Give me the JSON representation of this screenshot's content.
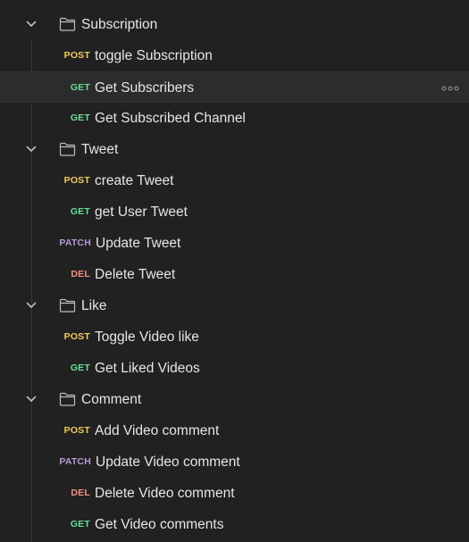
{
  "folders": [
    {
      "name": "Subscription",
      "icon": "folder-icon",
      "expanded": true,
      "requests": [
        {
          "method": "POST",
          "name": "toggle Subscription"
        },
        {
          "method": "GET",
          "name": "Get Subscribers",
          "active": true,
          "more_icon": "more-icon"
        },
        {
          "method": "GET",
          "name": "Get Subscribed Channel"
        }
      ]
    },
    {
      "name": "Tweet",
      "icon": "folder-icon",
      "expanded": true,
      "requests": [
        {
          "method": "POST",
          "name": "create Tweet"
        },
        {
          "method": "GET",
          "name": "get User Tweet"
        },
        {
          "method": "PATCH",
          "name": "Update Tweet"
        },
        {
          "method": "DEL",
          "name": "Delete Tweet"
        }
      ]
    },
    {
      "name": "Like",
      "icon": "folder-icon",
      "expanded": true,
      "requests": [
        {
          "method": "POST",
          "name": "Toggle Video like"
        },
        {
          "method": "GET",
          "name": "Get Liked Videos"
        }
      ]
    },
    {
      "name": "Comment",
      "icon": "folder-icon",
      "expanded": true,
      "requests": [
        {
          "method": "POST",
          "name": "Add Video comment"
        },
        {
          "method": "PATCH",
          "name": "Update Video comment"
        },
        {
          "method": "DEL",
          "name": "Delete Video comment"
        },
        {
          "method": "GET",
          "name": "Get Video comments"
        }
      ]
    }
  ],
  "colors": {
    "background": "#212121",
    "text": "#e6e6e6",
    "POST": "#f0cc62",
    "GET": "#6bdd9a",
    "PATCH": "#b79ad8",
    "DEL": "#f0917f",
    "active_row": "#2c2c2c"
  }
}
